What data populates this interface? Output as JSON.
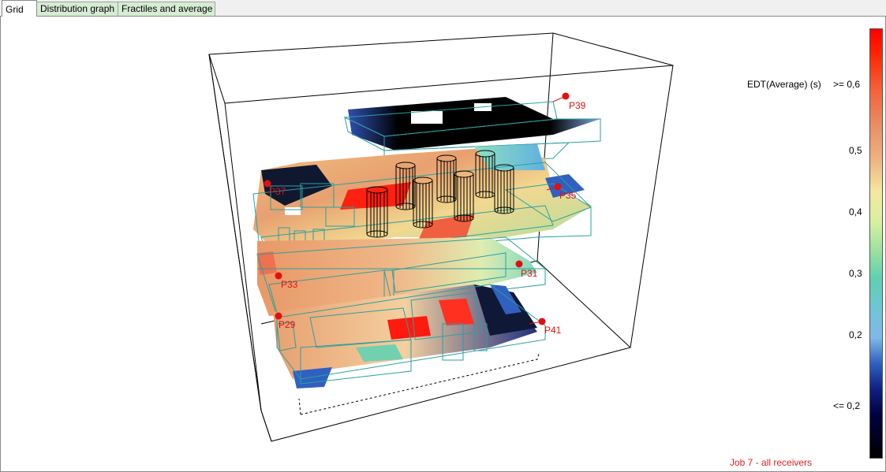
{
  "tabs": [
    {
      "label": "Grid",
      "active": true
    },
    {
      "label": "Distribution graph",
      "active": false
    },
    {
      "label": "Fractiles and average",
      "active": false
    }
  ],
  "legend": {
    "title": "EDT(Average) (s)",
    "max_label": ">= 0,6",
    "ticks": [
      "0,5",
      "0,4",
      "0,3",
      "0,2"
    ],
    "min_label": "<= 0,2",
    "colors": [
      "#ff0000",
      "#f08050",
      "#f4e8a0",
      "#60d0b0",
      "#80b8e8",
      "#102080",
      "#000000"
    ]
  },
  "receivers": [
    "P39",
    "P35",
    "P31",
    "P33",
    "P29",
    "P41",
    "P37"
  ],
  "caption": "Job 7 - all receivers",
  "colors": {
    "receiver": "#e01010",
    "outline": "#2aa0a0",
    "frame": "#000000"
  }
}
